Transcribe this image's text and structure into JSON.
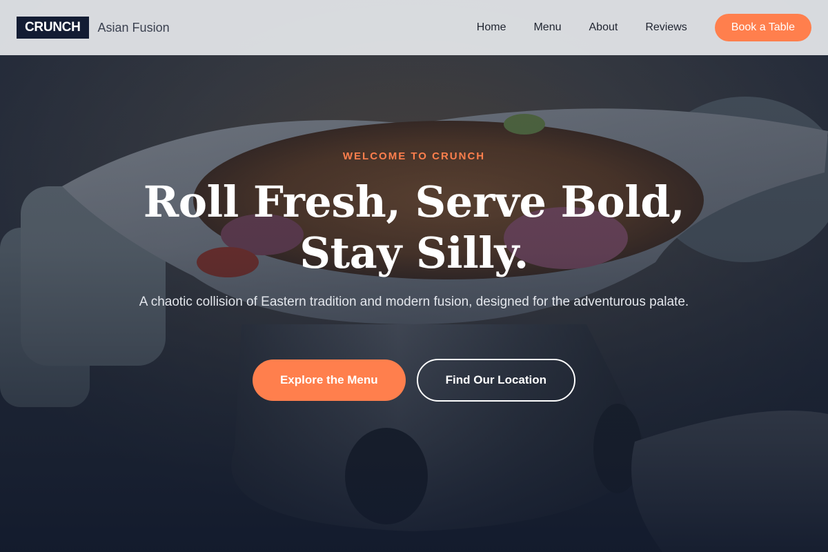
{
  "brand": {
    "logo_text": "CRUNCH",
    "tagline": "Asian Fusion"
  },
  "nav": {
    "links": [
      "Home",
      "Menu",
      "About",
      "Reviews"
    ],
    "cta_label": "Book a Table"
  },
  "hero": {
    "eyebrow": "WELCOME TO CRUNCH",
    "headline_line1": "Roll Fresh, Serve Bold,",
    "headline_line2": "Stay Silly.",
    "subtitle": "A chaotic collision of Eastern tradition and modern fusion, designed for the adventurous palate.",
    "primary_cta": "Explore the Menu",
    "secondary_cta": "Find Our Location",
    "background_image": "food-bowl-photo"
  },
  "colors": {
    "accent": "#ff7f4d",
    "logo_bg": "#131c33",
    "navbar_bg": "#e2e4e7",
    "hero_overlay": "#141c2c"
  }
}
